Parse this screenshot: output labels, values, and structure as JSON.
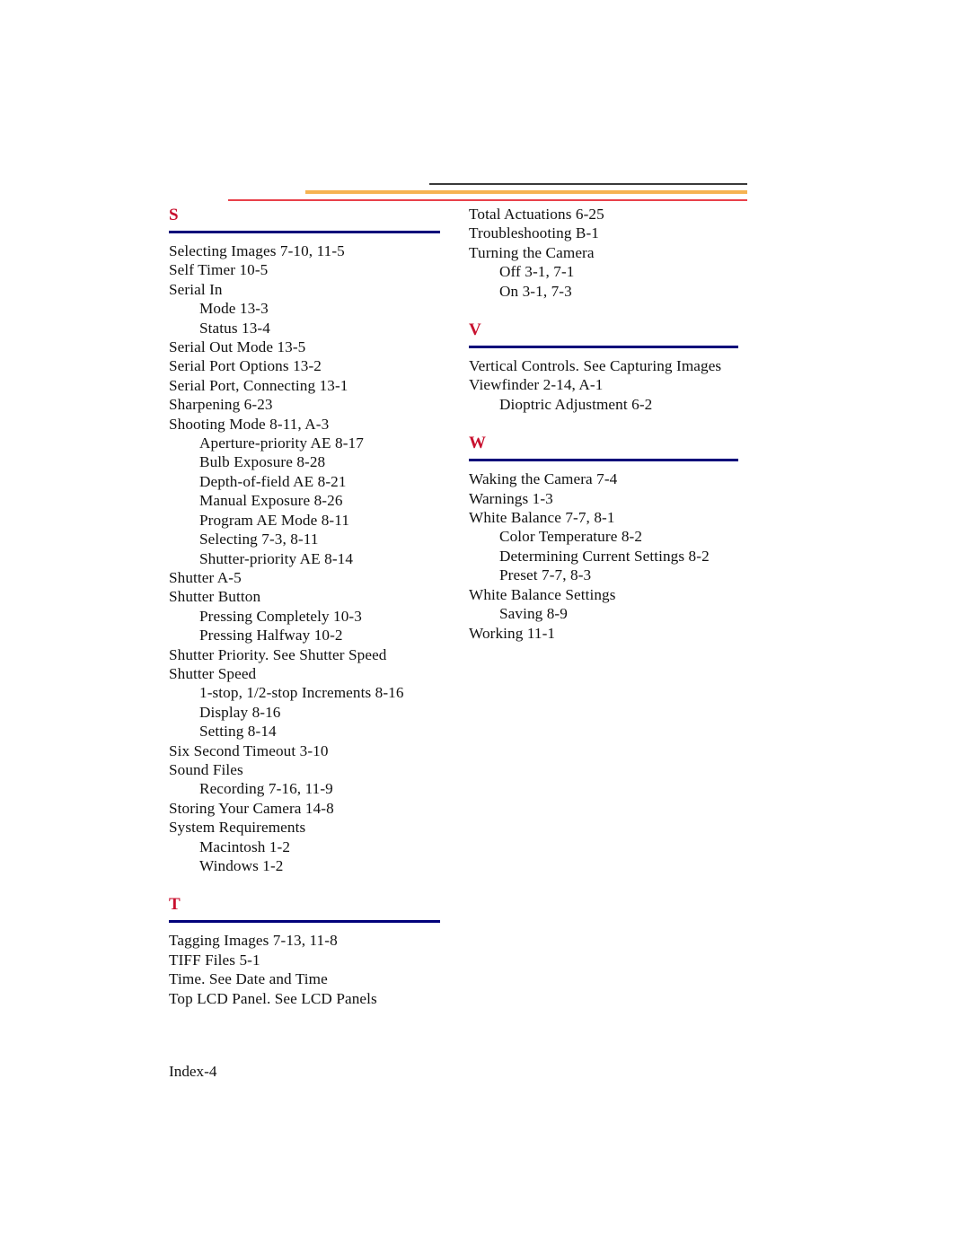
{
  "document": {
    "type": "index-page",
    "footer_page_label": "Index-4"
  },
  "header_rules": [
    {
      "name": "rule-black",
      "color": "#3a3a3a"
    },
    {
      "name": "rule-orange",
      "color": "#f6b352"
    },
    {
      "name": "rule-red",
      "color": "#e8404a"
    }
  ],
  "style_colors": {
    "section_letter": "#c8102e",
    "section_rule": "#00007a",
    "text": "#111111"
  },
  "columns": {
    "left": {
      "sections": [
        {
          "letter": "S",
          "entries": [
            {
              "text": "Selecting Images 7-10, 11-5",
              "level": 0
            },
            {
              "text": "Self Timer 10-5",
              "level": 0
            },
            {
              "text": "Serial In",
              "level": 0
            },
            {
              "text": "Mode 13-3",
              "level": 1
            },
            {
              "text": "Status 13-4",
              "level": 1
            },
            {
              "text": "Serial Out Mode 13-5",
              "level": 0
            },
            {
              "text": "Serial Port Options 13-2",
              "level": 0
            },
            {
              "text": "Serial Port, Connecting 13-1",
              "level": 0
            },
            {
              "text": "Sharpening 6-23",
              "level": 0
            },
            {
              "text": "Shooting Mode 8-11, A-3",
              "level": 0
            },
            {
              "text": "Aperture-priority AE 8-17",
              "level": 1
            },
            {
              "text": "Bulb Exposure 8-28",
              "level": 1
            },
            {
              "text": "Depth-of-field AE 8-21",
              "level": 1
            },
            {
              "text": "Manual Exposure 8-26",
              "level": 1
            },
            {
              "text": "Program AE Mode 8-11",
              "level": 1
            },
            {
              "text": "Selecting 7-3, 8-11",
              "level": 1
            },
            {
              "text": "Shutter-priority AE 8-14",
              "level": 1
            },
            {
              "text": "Shutter A-5",
              "level": 0
            },
            {
              "text": "Shutter Button",
              "level": 0
            },
            {
              "text": "Pressing Completely 10-3",
              "level": 1
            },
            {
              "text": "Pressing Halfway 10-2",
              "level": 1
            },
            {
              "text": "Shutter Priority. See Shutter Speed",
              "level": 0
            },
            {
              "text": "Shutter Speed",
              "level": 0
            },
            {
              "text": "1-stop, 1/2-stop Increments 8-16",
              "level": 1
            },
            {
              "text": "Display 8-16",
              "level": 1
            },
            {
              "text": "Setting 8-14",
              "level": 1
            },
            {
              "text": "Six Second Timeout 3-10",
              "level": 0
            },
            {
              "text": "Sound Files",
              "level": 0
            },
            {
              "text": "Recording 7-16, 11-9",
              "level": 1
            },
            {
              "text": "Storing Your Camera 14-8",
              "level": 0
            },
            {
              "text": "System Requirements",
              "level": 0
            },
            {
              "text": "Macintosh 1-2",
              "level": 1
            },
            {
              "text": "Windows 1-2",
              "level": 1
            }
          ]
        },
        {
          "letter": "T",
          "entries": [
            {
              "text": "Tagging Images 7-13, 11-8",
              "level": 0
            },
            {
              "text": "TIFF Files 5-1",
              "level": 0
            },
            {
              "text": "Time. See Date and Time",
              "level": 0
            },
            {
              "text": "Top LCD Panel. See LCD Panels",
              "level": 0
            }
          ]
        }
      ]
    },
    "right": {
      "sections": [
        {
          "letter": "",
          "continued": true,
          "entries": [
            {
              "text": "Total Actuations 6-25",
              "level": 0
            },
            {
              "text": "Troubleshooting B-1",
              "level": 0
            },
            {
              "text": "Turning the Camera",
              "level": 0
            },
            {
              "text": "Off 3-1, 7-1",
              "level": 1
            },
            {
              "text": "On 3-1, 7-3",
              "level": 1
            }
          ]
        },
        {
          "letter": "V",
          "entries": [
            {
              "text": "Vertical Controls. See Capturing Images",
              "level": 0
            },
            {
              "text": "Viewfinder 2-14, A-1",
              "level": 0
            },
            {
              "text": "Dioptric Adjustment 6-2",
              "level": 1
            }
          ]
        },
        {
          "letter": "W",
          "entries": [
            {
              "text": "Waking the Camera 7-4",
              "level": 0
            },
            {
              "text": "Warnings 1-3",
              "level": 0
            },
            {
              "text": "White Balance 7-7, 8-1",
              "level": 0
            },
            {
              "text": "Color Temperature 8-2",
              "level": 1
            },
            {
              "text": "Determining Current Settings 8-2",
              "level": 1
            },
            {
              "text": "Preset 7-7, 8-3",
              "level": 1
            },
            {
              "text": "White Balance Settings",
              "level": 0
            },
            {
              "text": "Saving 8-9",
              "level": 1
            },
            {
              "text": "Working 11-1",
              "level": 0
            }
          ]
        }
      ]
    }
  }
}
